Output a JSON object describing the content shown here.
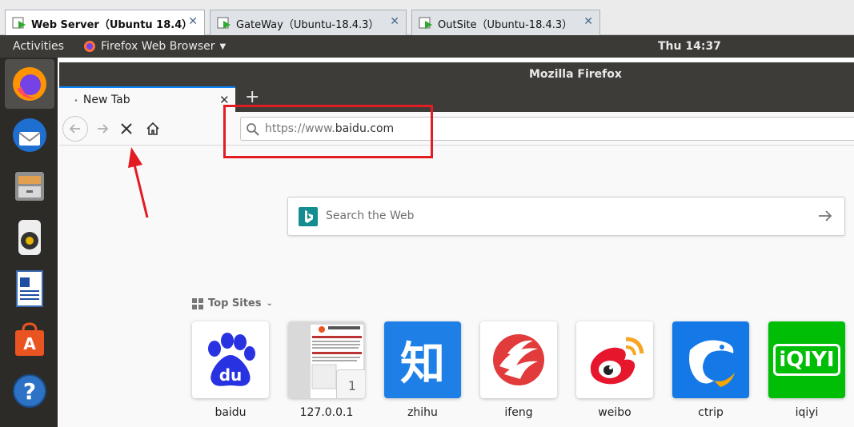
{
  "vm_tabs": [
    {
      "label": "Web Server（Ubuntu 18.4）",
      "active": true
    },
    {
      "label": "GateWay（Ubuntu-18.4.3）",
      "active": false
    },
    {
      "label": "OutSite（Ubuntu-18.4.3）",
      "active": false
    }
  ],
  "panel": {
    "activities": "Activities",
    "app_menu": "Firefox Web Browser",
    "clock": "Thu 14:37"
  },
  "dock": {
    "items": [
      "firefox-icon",
      "thunderbird-icon",
      "files-icon",
      "rhythmbox-icon",
      "writer-icon",
      "software-icon",
      "help-icon"
    ]
  },
  "firefox": {
    "window_title": "Mozilla Firefox",
    "tab_label": "New Tab",
    "url_prefix": "https://www.",
    "url_domain": "baidu.com",
    "search_placeholder": "Search the Web",
    "top_sites_heading": "Top Sites",
    "top_sites": [
      {
        "label": "baidu",
        "icon": "baidu-icon"
      },
      {
        "label": "127.0.0.1",
        "icon": "page-thumbnail",
        "badge": "1"
      },
      {
        "label": "zhihu",
        "icon": "zhihu-icon",
        "glyph": "知"
      },
      {
        "label": "ifeng",
        "icon": "ifeng-icon"
      },
      {
        "label": "weibo",
        "icon": "weibo-icon"
      },
      {
        "label": "ctrip",
        "icon": "ctrip-icon"
      },
      {
        "label": "iqiyi",
        "icon": "iqiyi-icon",
        "glyph": "iQIYI"
      }
    ]
  },
  "colors": {
    "accent_blue": "#0a84ff",
    "annotation_red": "#e31b23",
    "panel": "#3b3a36"
  }
}
